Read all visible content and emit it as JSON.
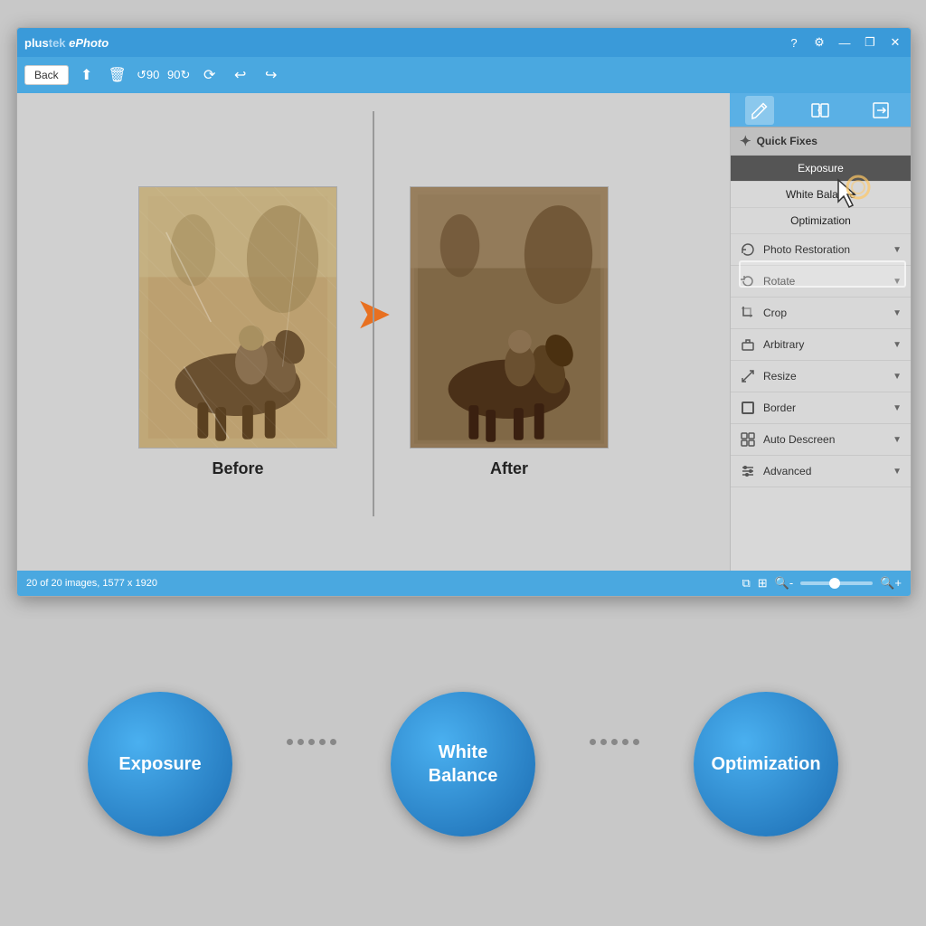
{
  "app": {
    "title_plus": "plus",
    "title_tek": "tek",
    "title_ephoto": " ePhoto",
    "window_controls": {
      "help": "?",
      "settings": "⚙",
      "minimize": "—",
      "restore": "❐",
      "close": "✕"
    }
  },
  "toolbar": {
    "back_label": "Back",
    "icons": [
      "⬆",
      "🗑",
      "↺",
      "↻",
      "⟳",
      "↩",
      "↪"
    ]
  },
  "panel_tabs": {
    "tab1_icon": "✏",
    "tab2_icon": "⊞",
    "tab3_icon": "⊟"
  },
  "before_label": "Before",
  "after_label": "After",
  "quick_fixes": {
    "header": "Quick Fixes",
    "items": [
      "Exposure",
      "White Balance",
      "Optimization"
    ]
  },
  "panel_items": [
    {
      "id": "photo-restoration",
      "label": "Photo Restoration",
      "icon": "🔄"
    },
    {
      "id": "rotate",
      "label": "Rotate",
      "icon": "↻"
    },
    {
      "id": "crop",
      "label": "Crop",
      "icon": "⊡"
    },
    {
      "id": "arbitrary",
      "label": "Arbitrary",
      "icon": "⊟"
    },
    {
      "id": "resize",
      "label": "Resize",
      "icon": "⤡"
    },
    {
      "id": "border",
      "label": "Border",
      "icon": "▭"
    },
    {
      "id": "auto-descreen",
      "label": "Auto Descreen",
      "icon": "⊞"
    },
    {
      "id": "advanced",
      "label": "Advanced",
      "icon": "≋"
    }
  ],
  "status": {
    "image_info": "20 of 20 images, 1577 x 1920"
  },
  "bottom_circles": [
    {
      "id": "exposure",
      "label": "Exposure"
    },
    {
      "id": "white-balance",
      "label": "White\nBalance"
    },
    {
      "id": "optimization",
      "label": "Optimization"
    }
  ]
}
